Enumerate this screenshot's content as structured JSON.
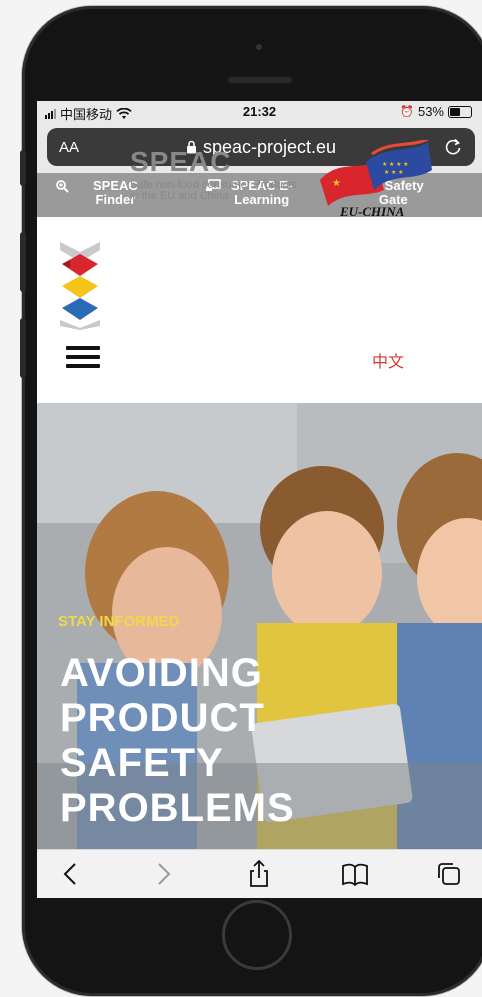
{
  "status_bar": {
    "carrier": "中国移动",
    "time": "21:32",
    "battery": "53%",
    "battery_level": 0.53
  },
  "browser": {
    "text_size": "AA",
    "url": "speac-project.eu"
  },
  "top_nav": {
    "items": [
      {
        "label": "SPEAC\nFinder",
        "icon": "magnifier-icon"
      },
      {
        "label": "SPEAC E-\nLearning",
        "icon": "screen-icon"
      },
      {
        "label": "EU Safety\nGate",
        "icon": "gift-icon"
      }
    ]
  },
  "header": {
    "brand_name": "SPEAC",
    "tagline": "Safe non-food consumer Products in the EU and China",
    "partner_logo_text": "EU-CHINA",
    "language_link": "中文"
  },
  "hero": {
    "eyebrow": "STAY INFORMED",
    "headline_lines": [
      "AVOIDING",
      "PRODUCT",
      "SAFETY",
      "PROBLEMS"
    ]
  },
  "colors": {
    "nav_gray": "#9a9a9a",
    "accent_yellow": "#f0d94a",
    "lang_red": "#d23a2c",
    "logo_red": "#d9262c",
    "logo_yellow": "#f5c518",
    "logo_blue": "#2b6ab4"
  },
  "toolbar": {
    "icons": [
      "back-icon",
      "forward-icon",
      "share-icon",
      "bookmarks-icon",
      "tabs-icon"
    ]
  }
}
